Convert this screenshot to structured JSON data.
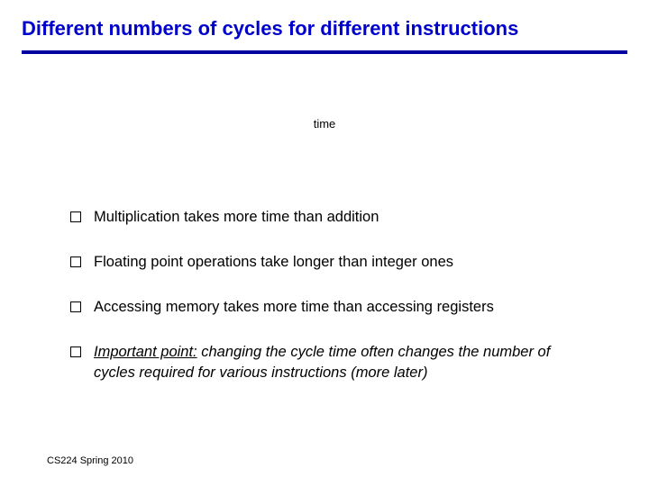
{
  "slide": {
    "title": "Different numbers of cycles for different instructions",
    "diagram": {
      "time_label": "time"
    },
    "bullets": [
      {
        "text": "Multiplication takes more time than addition",
        "style": "plain"
      },
      {
        "text": "Floating point operations take longer than integer ones",
        "style": "plain"
      },
      {
        "text": "Accessing memory takes more time than accessing registers",
        "style": "plain"
      },
      {
        "lead": "Important point:",
        "rest": "  changing the cycle time often changes the number of cycles required for various instructions (more later)",
        "style": "italic"
      }
    ],
    "footer": "CS224 Spring 2010"
  }
}
